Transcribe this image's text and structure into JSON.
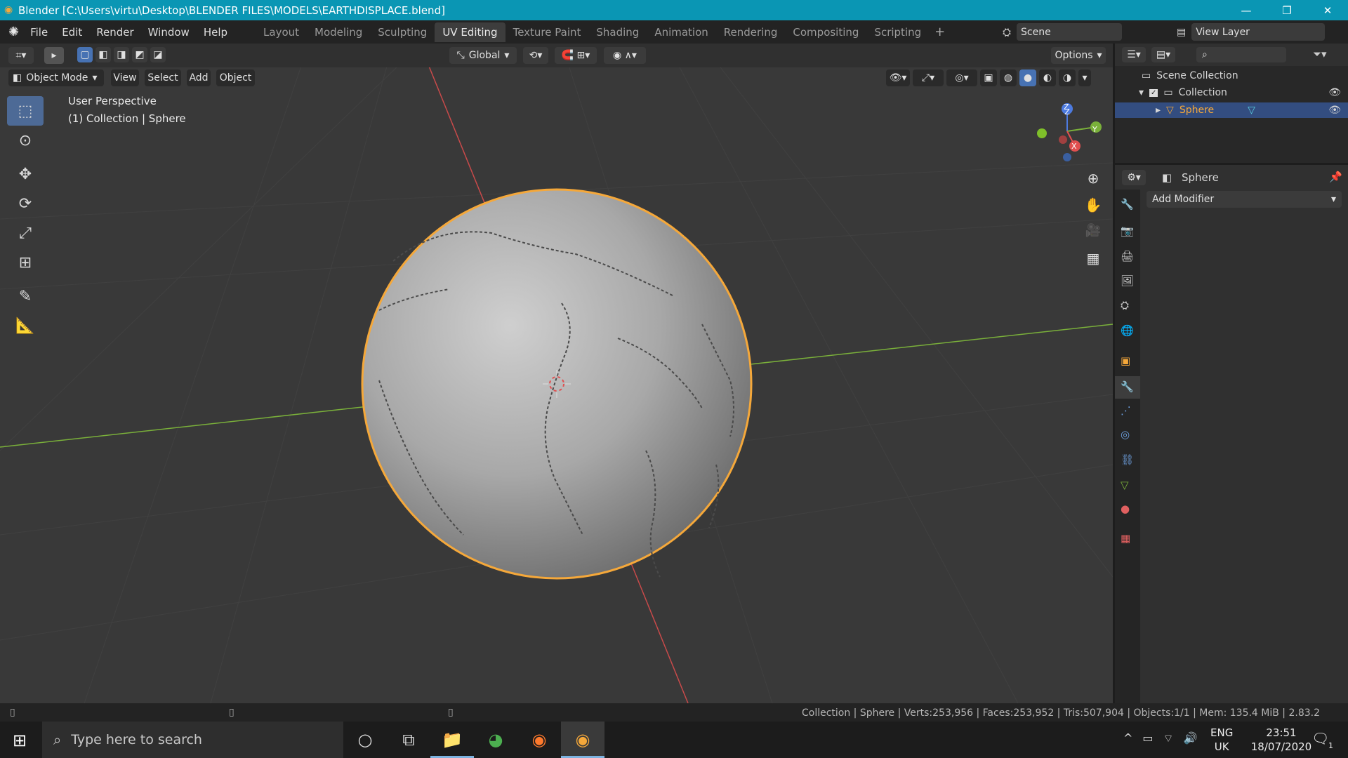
{
  "window": {
    "title": "Blender [C:\\Users\\virtu\\Desktop\\BLENDER FILES\\MODELS\\EARTHDISPLACE.blend]",
    "minimize": "—",
    "maximize": "❐",
    "close": "✕"
  },
  "menu": [
    "File",
    "Edit",
    "Render",
    "Window",
    "Help"
  ],
  "workspaces": [
    {
      "label": "Layout",
      "active": false
    },
    {
      "label": "Modeling",
      "active": false
    },
    {
      "label": "Sculpting",
      "active": false
    },
    {
      "label": "UV Editing",
      "active": true
    },
    {
      "label": "Texture Paint",
      "active": false
    },
    {
      "label": "Shading",
      "active": false
    },
    {
      "label": "Animation",
      "active": false
    },
    {
      "label": "Rendering",
      "active": false
    },
    {
      "label": "Compositing",
      "active": false
    },
    {
      "label": "Scripting",
      "active": false
    }
  ],
  "scene": {
    "label": "Scene",
    "view_layer": "View Layer"
  },
  "viewport_header": {
    "transform_orientation": "Global",
    "options": "Options",
    "mode": "Object Mode",
    "menus": [
      "View",
      "Select",
      "Add",
      "Object"
    ]
  },
  "viewport": {
    "perspective": "User Perspective",
    "collection_info": "(1) Collection | Sphere",
    "gizmo_axes": [
      "X",
      "Y",
      "Z"
    ]
  },
  "outliner": {
    "root": "Scene Collection",
    "collection": "Collection",
    "object": "Sphere"
  },
  "properties": {
    "object_name": "Sphere",
    "add_modifier": "Add Modifier"
  },
  "statusbar": {
    "text": "Collection | Sphere | Verts:253,956 | Faces:253,952 | Tris:507,904 | Objects:1/1 | Mem: 135.4 MiB | 2.83.2"
  },
  "taskbar": {
    "search_placeholder": "Type here to search",
    "lang": "ENG",
    "region": "UK",
    "time": "23:51",
    "date": "18/07/2020",
    "notification_count": "1"
  },
  "colors": {
    "selection_orange": "#f5a83a",
    "title_blue": "#0a96b4",
    "active_blue": "#4772b3",
    "x_axis": "#c94a4a",
    "y_axis": "#7ab03a"
  }
}
